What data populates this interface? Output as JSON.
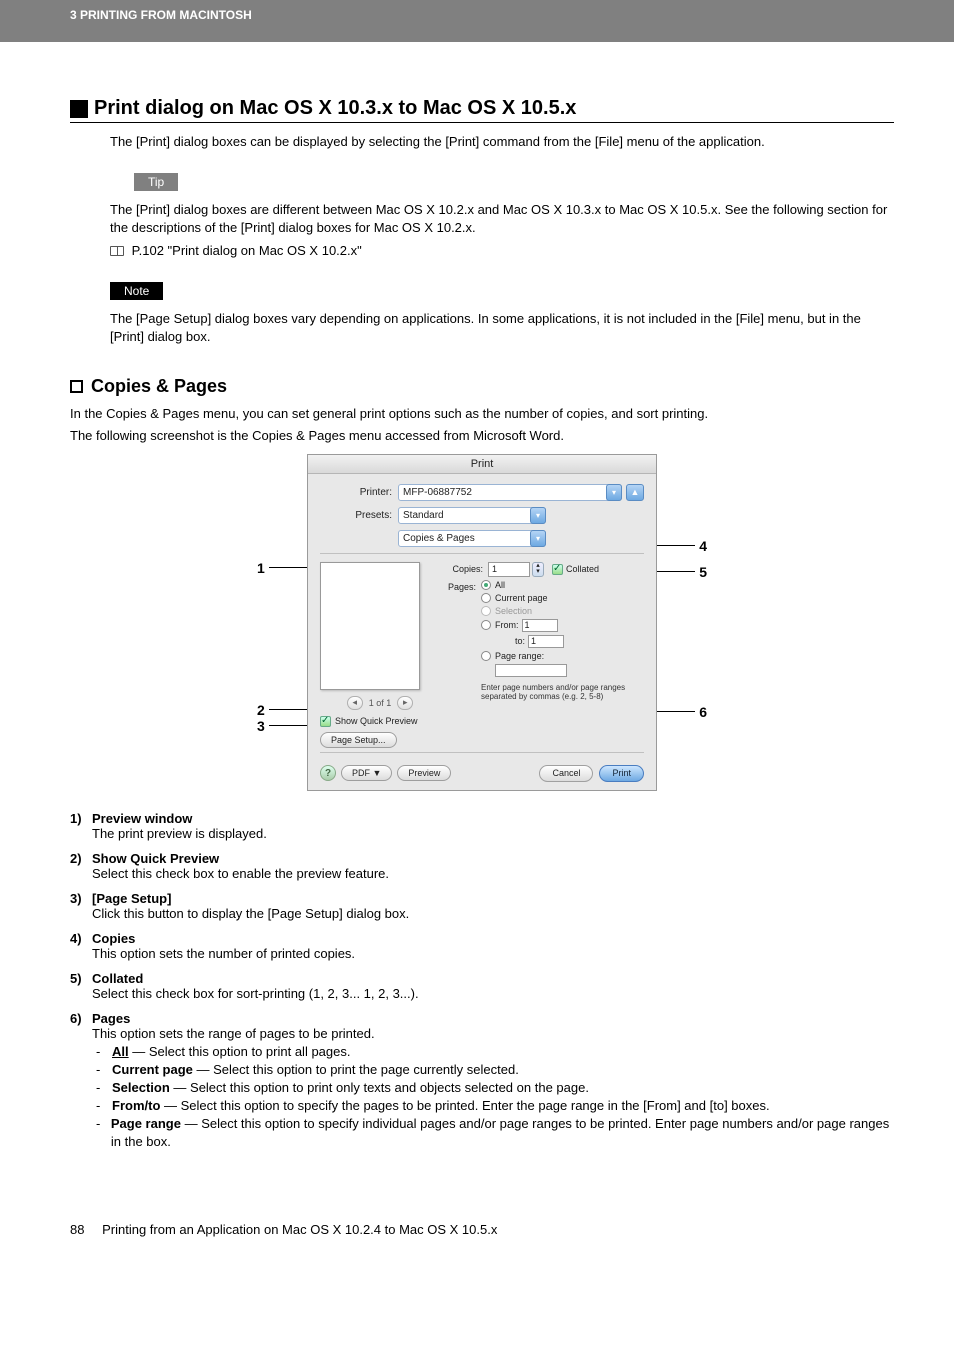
{
  "header": {
    "chapter": "3 PRINTING FROM MACINTOSH"
  },
  "section": {
    "h2": "Print dialog on Mac OS X 10.3.x to Mac OS X 10.5.x",
    "intro": "The [Print] dialog boxes can be displayed by selecting the [Print] command from the [File] menu of the application.",
    "tip_label": "Tip",
    "tip1": "The [Print] dialog boxes are different between Mac OS X 10.2.x and Mac OS X 10.3.x to Mac OS X 10.5.x. See the following section for the descriptions of the [Print] dialog boxes for Mac OS X 10.2.x.",
    "tip_ref": "P.102 \"Print dialog on Mac OS X 10.2.x\"",
    "note_label": "Note",
    "note1": "The [Page Setup] dialog boxes vary depending on applications. In some applications, it is not included in the [File] menu, but in the [Print] dialog box.",
    "h3": "Copies & Pages",
    "h3_intro1": "In the Copies & Pages menu, you can set general print options such as the number of copies, and sort printing.",
    "h3_intro2": "The following screenshot is the Copies & Pages menu accessed from Microsoft Word."
  },
  "callouts": {
    "c1": "1",
    "c2": "2",
    "c3": "3",
    "c4": "4",
    "c5": "5",
    "c6": "6"
  },
  "dialog": {
    "title": "Print",
    "printer_label": "Printer:",
    "printer_value": "MFP-06887752",
    "presets_label": "Presets:",
    "presets_value": "Standard",
    "panel_value": "Copies & Pages",
    "copies_label": "Copies:",
    "copies_value": "1",
    "collated_label": "Collated",
    "pages_label": "Pages:",
    "opt_all": "All",
    "opt_current": "Current page",
    "opt_selection": "Selection",
    "opt_from": "From:",
    "from_value": "1",
    "to_label": "to:",
    "to_value": "1",
    "opt_pagerange": "Page range:",
    "pagerange_hint": "Enter page numbers and/or page ranges separated by commas (e.g. 2, 5-8)",
    "nav_pages": "1 of 1",
    "show_quick": "Show Quick Preview",
    "page_setup_btn": "Page Setup...",
    "pdf_btn": "PDF ▼",
    "preview_btn": "Preview",
    "cancel_btn": "Cancel",
    "print_btn": "Print"
  },
  "items": {
    "i1": {
      "num": "1)",
      "title": "Preview window",
      "desc": "The print preview is displayed."
    },
    "i2": {
      "num": "2)",
      "title": "Show Quick Preview",
      "desc": "Select this check box to enable the preview feature."
    },
    "i3": {
      "num": "3)",
      "title": "[Page Setup]",
      "desc": "Click this button to display the [Page Setup] dialog box."
    },
    "i4": {
      "num": "4)",
      "title": "Copies",
      "desc": "This option sets the number of printed copies."
    },
    "i5": {
      "num": "5)",
      "title": "Collated",
      "desc": "Select this check box for sort-printing (1, 2, 3... 1, 2, 3...)."
    },
    "i6": {
      "num": "6)",
      "title": "Pages",
      "desc": "This option sets the range of pages to be printed.",
      "sub": {
        "all_lead": "All",
        "all_rest": " — Select this option to print all pages.",
        "cur_lead": "Current page",
        "cur_rest": " — Select this option to print the page currently selected.",
        "sel_lead": "Selection",
        "sel_rest": " — Select this option to print only texts and objects selected on the page.",
        "ft_lead": "From/to",
        "ft_rest": " — Select this option to specify the pages to be printed. Enter the page range in the [From] and [to] boxes.",
        "pr_lead": "Page range",
        "pr_rest": " — Select this option to specify individual pages and/or page ranges to be printed. Enter page numbers and/or page ranges in the box."
      }
    }
  },
  "footer": {
    "page": "88",
    "title": "Printing from an Application on Mac OS X 10.2.4 to Mac OS X 10.5.x"
  }
}
